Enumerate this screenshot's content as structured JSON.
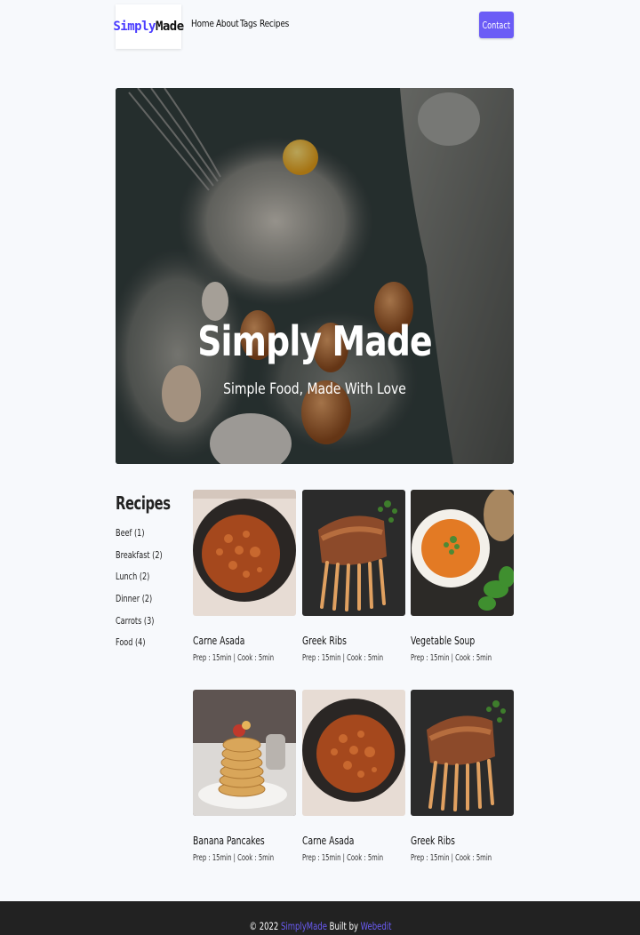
{
  "nav": {
    "logo_part1": "Simply",
    "logo_part2": "Made",
    "links": [
      "Home",
      "About",
      "Tags",
      "Recipes"
    ],
    "contact_label": "Contact"
  },
  "hero": {
    "title": "Simply Made",
    "subtitle": "Simple Food, Made With Love"
  },
  "sidebar": {
    "title": "Recipes",
    "tags": [
      "Beef (1)",
      "Breakfast (2)",
      "Lunch (2)",
      "Dinner (2)",
      "Carrots (3)",
      "Food (4)"
    ]
  },
  "recipes": [
    {
      "name": "Carne Asada",
      "meta": "Prep : 15min | Cook : 5min",
      "image": "carne-asada-photo"
    },
    {
      "name": "Greek Ribs",
      "meta": "Prep : 15min | Cook : 5min",
      "image": "greek-ribs-photo"
    },
    {
      "name": "Vegetable Soup",
      "meta": "Prep : 15min | Cook : 5min",
      "image": "vegetable-soup-photo"
    },
    {
      "name": "Banana Pancakes",
      "meta": "Prep : 15min | Cook : 5min",
      "image": "banana-pancakes-photo"
    },
    {
      "name": "Carne Asada",
      "meta": "Prep : 15min | Cook : 5min",
      "image": "carne-asada-photo"
    },
    {
      "name": "Greek Ribs",
      "meta": "Prep : 15min | Cook : 5min",
      "image": "greek-ribs-photo"
    }
  ],
  "footer": {
    "prefix": "© 2022",
    "brand": "SimplyMade",
    "built_by": "Built by",
    "built_link": "Webedit"
  },
  "colors": {
    "accent": "#6b5cf6",
    "background": "#f7f9fc",
    "footer_bg": "#222222"
  }
}
